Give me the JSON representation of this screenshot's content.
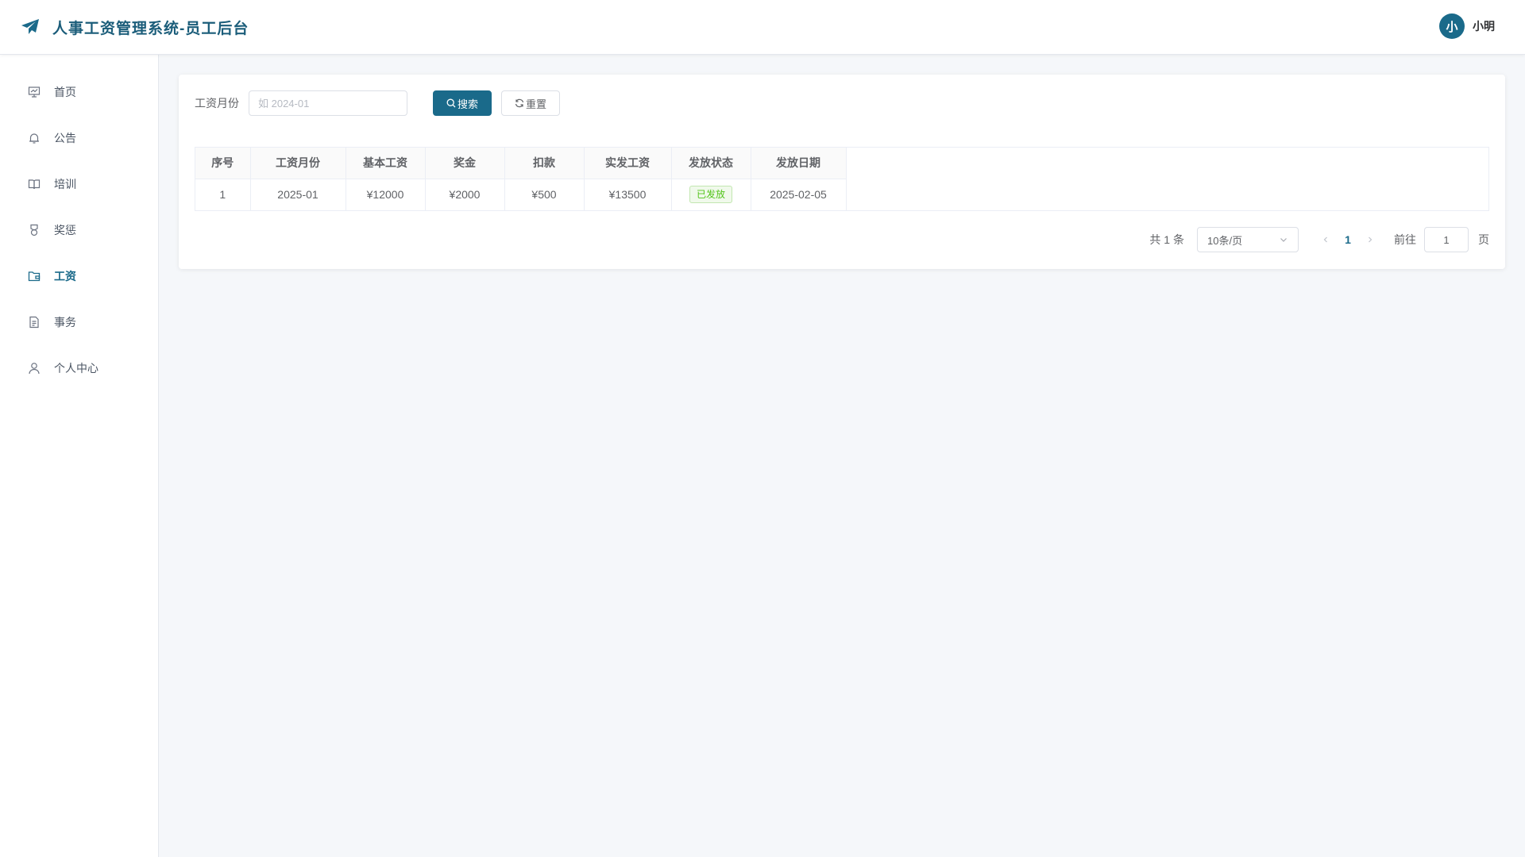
{
  "header": {
    "title": "人事工资管理系统-员工后台",
    "user": {
      "avatar_text": "小",
      "name": "小明"
    }
  },
  "sidebar": {
    "items": [
      {
        "label": "首页",
        "icon": "presentation-icon",
        "active": false
      },
      {
        "label": "公告",
        "icon": "bell-icon",
        "active": false
      },
      {
        "label": "培训",
        "icon": "book-icon",
        "active": false
      },
      {
        "label": "奖惩",
        "icon": "medal-icon",
        "active": false
      },
      {
        "label": "工资",
        "icon": "wallet-folder-icon",
        "active": true
      },
      {
        "label": "事务",
        "icon": "document-icon",
        "active": false
      },
      {
        "label": "个人中心",
        "icon": "user-icon",
        "active": false
      }
    ]
  },
  "search": {
    "label": "工资月份",
    "placeholder": "如 2024-01",
    "value": "",
    "search_button": "搜索",
    "reset_button": "重置"
  },
  "table": {
    "columns": [
      "序号",
      "工资月份",
      "基本工资",
      "奖金",
      "扣款",
      "实发工资",
      "发放状态",
      "发放日期"
    ],
    "rows": [
      {
        "index": "1",
        "month": "2025-01",
        "base": "¥12000",
        "bonus": "¥2000",
        "deduction": "¥500",
        "net": "¥13500",
        "status": "已发放",
        "date": "2025-02-05"
      }
    ]
  },
  "pagination": {
    "total_text": "共 1 条",
    "page_size": "10条/页",
    "current_page": "1",
    "goto_label": "前往",
    "goto_value": "1",
    "page_unit": "页"
  },
  "colors": {
    "primary": "#1a6a8a",
    "title": "#1b5d7a",
    "success": "#52c41a",
    "background": "#f5f7fa"
  }
}
